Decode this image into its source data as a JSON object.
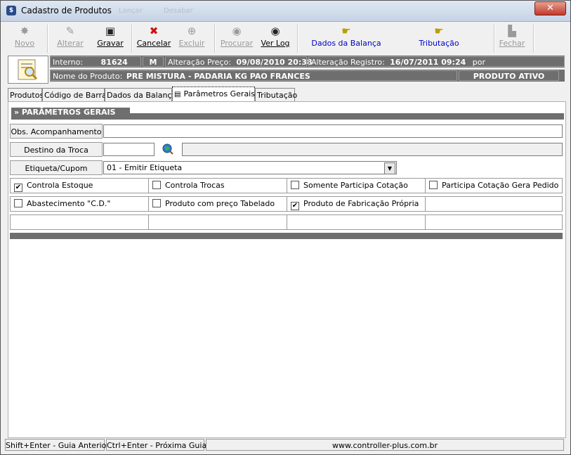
{
  "window": {
    "title": "Cadastro de Produtos",
    "ghost_items": [
      "Lançar",
      "Desabar"
    ],
    "close_glyph": "✕"
  },
  "toolbar": {
    "buttons": [
      {
        "label": "Novo",
        "icon": "star-burst-icon",
        "enabled": false
      },
      {
        "label": "Alterar",
        "icon": "edit-icon",
        "enabled": false
      },
      {
        "label": "Gravar",
        "icon": "floppy-disk-icon",
        "enabled": true
      },
      {
        "label": "Cancelar",
        "icon": "red-x-icon",
        "enabled": true
      },
      {
        "label": "Excluir",
        "icon": "trash-icon",
        "enabled": false
      },
      {
        "label": "Procurar",
        "icon": "globe-search-icon",
        "enabled": false
      },
      {
        "label": "Ver Log",
        "icon": "eye-icon",
        "enabled": true
      },
      {
        "label": "Dados da Balança",
        "icon": "pointing-hand-icon",
        "enabled": true
      },
      {
        "label": "Tributação",
        "icon": "pointing-hand-icon",
        "enabled": true
      },
      {
        "label": "Fechar",
        "icon": "exit-icon",
        "enabled": false
      }
    ]
  },
  "header": {
    "interno_label": "Interno:",
    "interno_value": "81624",
    "tipo": "M",
    "alteracao_preco_label": "Alteração Preço:",
    "alteracao_preco_value": "09/08/2010 20:38",
    "alteracao_registro_label": "Alteração Registro:",
    "alteracao_registro_value": "16/07/2011  09:24",
    "por_label": "por",
    "nome_label": "Nome do Produto:",
    "nome_value": "PRE MISTURA - PADARIA KG  PAO FRANCES",
    "status": "PRODUTO ATIVO"
  },
  "tabs": [
    {
      "label": "Produtos",
      "active": false
    },
    {
      "label": "Código de Barras",
      "active": false
    },
    {
      "label": "Dados da Balança",
      "active": false
    },
    {
      "label": "Parâmetros Gerais",
      "active": true
    },
    {
      "label": "Tributação",
      "active": false
    }
  ],
  "section": {
    "title": "» PARÂMETROS GERAIS",
    "obs_label": "Obs. Acompanhamento",
    "obs_value": "",
    "destino_label": "Destino da Troca",
    "destino_value": "",
    "destino_desc": "",
    "etiqueta_label": "Etiqueta/Cupom",
    "etiqueta_value": "01 - Emitir Etiqueta"
  },
  "checkboxes": [
    [
      {
        "label": "Controla Estoque",
        "checked": true
      },
      {
        "label": "Controla Trocas",
        "checked": false
      },
      {
        "label": "Somente Participa Cotação",
        "checked": false
      },
      {
        "label": "Participa Cotação Gera Pedido",
        "checked": false
      }
    ],
    [
      {
        "label": "Abastecimento \"C.D.\"",
        "checked": false
      },
      {
        "label": "Produto com preço Tabelado",
        "checked": false
      },
      {
        "label": "Produto de Fabricação Própria",
        "checked": true
      },
      {
        "label": "",
        "checked": null
      }
    ]
  ],
  "statusbar": {
    "prev": "Shift+Enter - Guia Anterior",
    "next": "Ctrl+Enter - Próxima Guia",
    "site": "www.controller-plus.com.br"
  }
}
